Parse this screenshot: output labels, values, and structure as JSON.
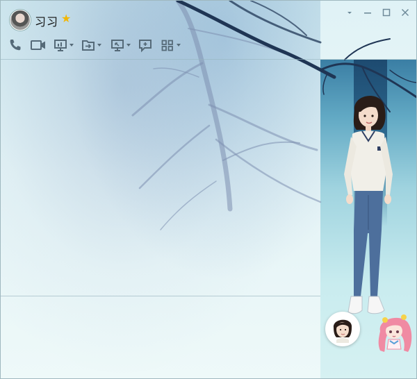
{
  "header": {
    "contact_name": "习习",
    "vip_badge_icon": "star-icon"
  },
  "window_controls": {
    "dropdown_icon": "chevron-down-icon",
    "minimize_icon": "minimize-icon",
    "maximize_icon": "maximize-icon",
    "close_icon": "close-icon"
  },
  "toolbar": {
    "items": [
      {
        "icon": "phone-icon",
        "has_dropdown": false
      },
      {
        "icon": "video-icon",
        "has_dropdown": false
      },
      {
        "icon": "presentation-icon",
        "has_dropdown": true
      },
      {
        "icon": "file-transfer-icon",
        "has_dropdown": true
      },
      {
        "icon": "screen-share-icon",
        "has_dropdown": true
      },
      {
        "icon": "add-message-icon",
        "has_dropdown": false
      },
      {
        "icon": "apps-grid-icon",
        "has_dropdown": true
      }
    ]
  },
  "colors": {
    "accent_star": "#f2b705",
    "icon": "#556a78",
    "divider": "#9fb8bf"
  }
}
